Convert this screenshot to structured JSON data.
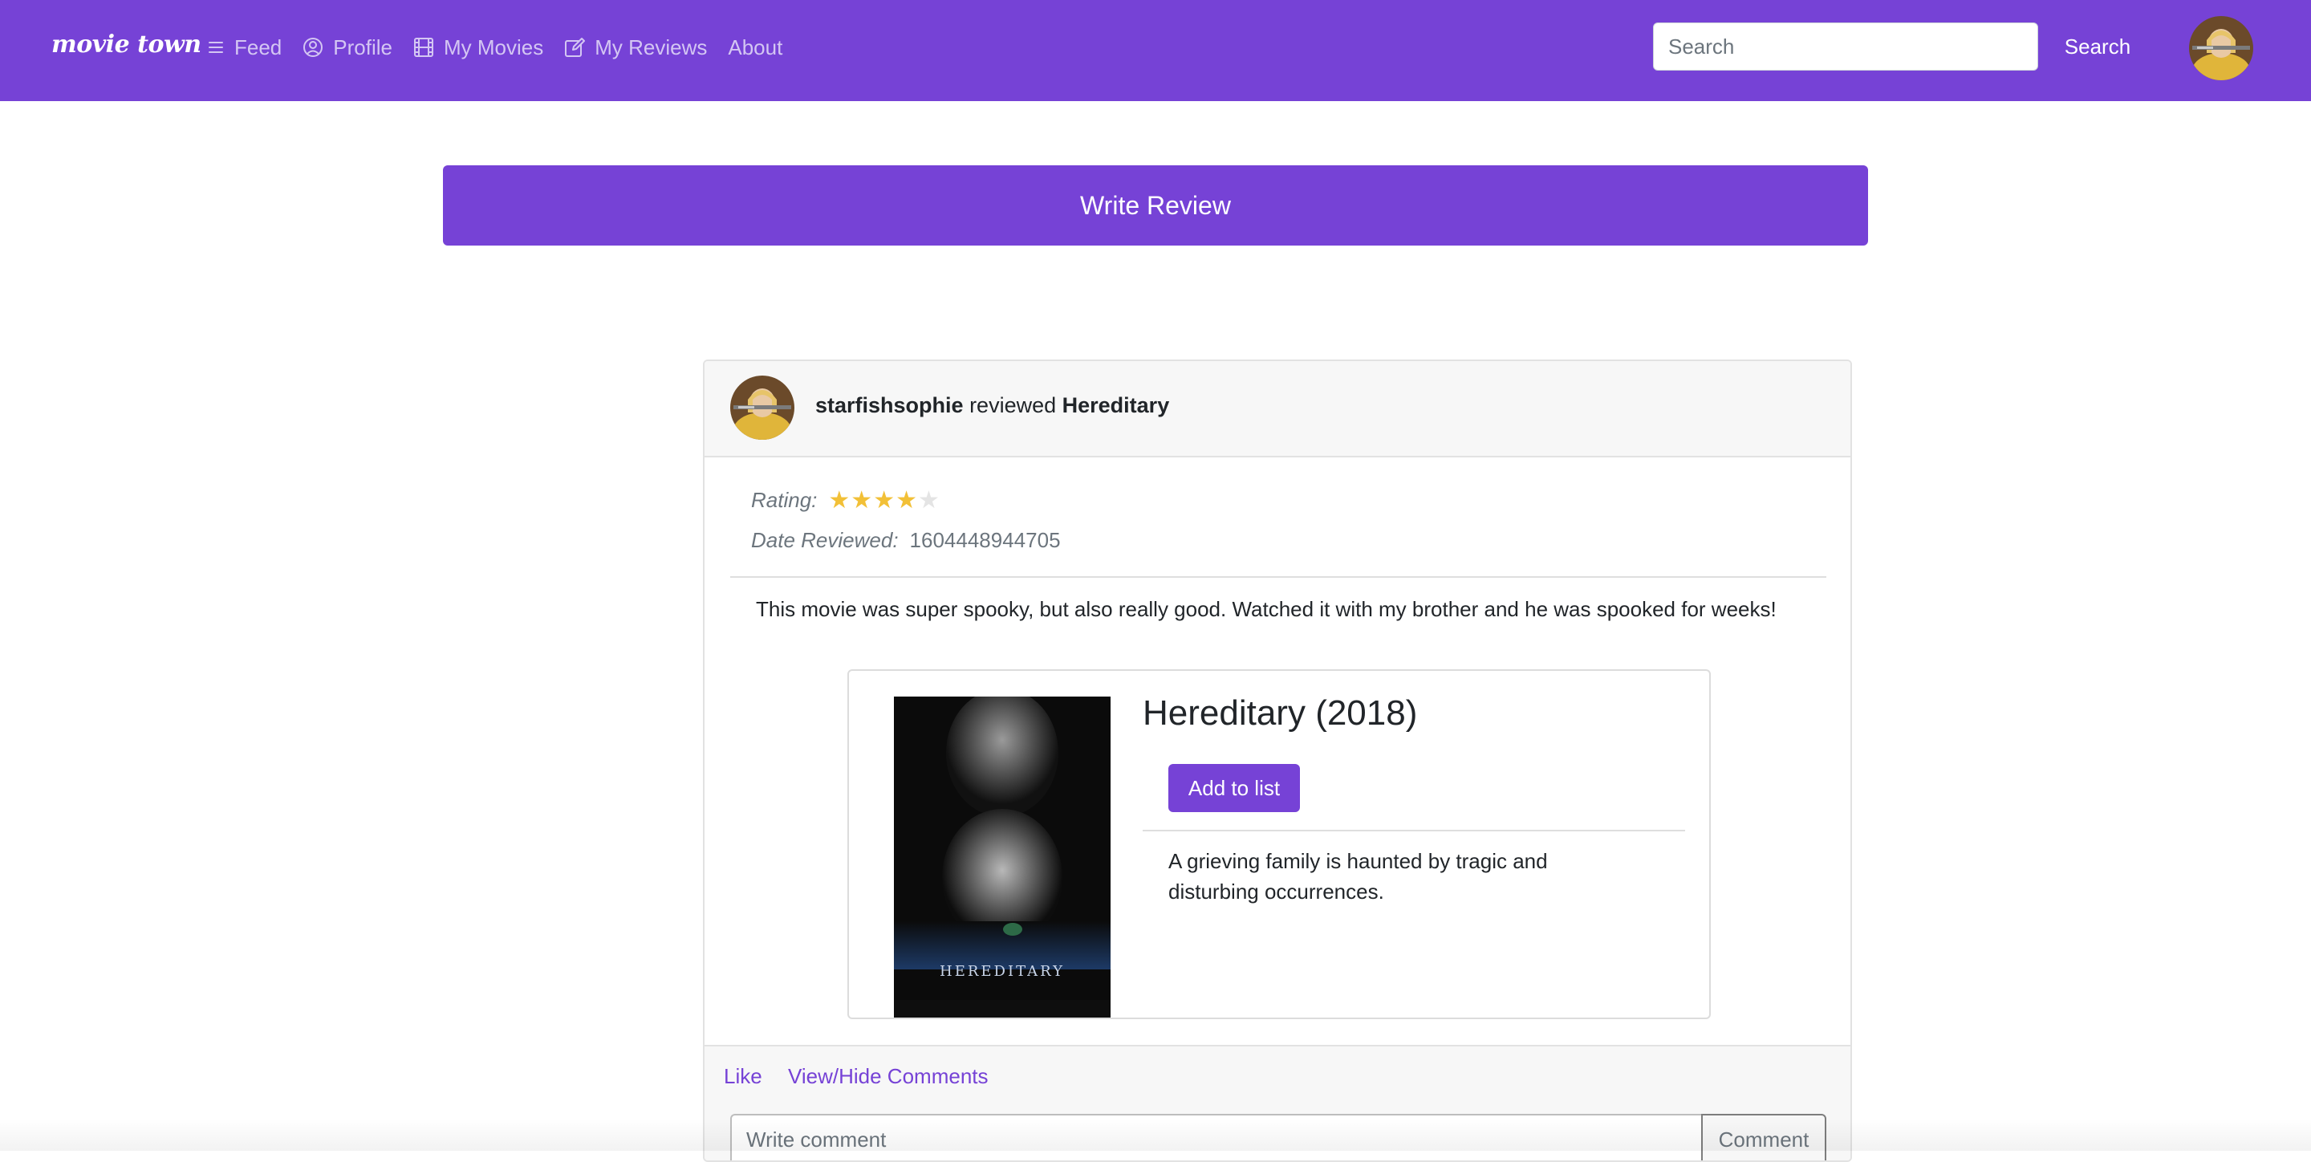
{
  "navbar": {
    "brand": "movie town",
    "links": [
      {
        "label": "Feed",
        "icon": "list-icon"
      },
      {
        "label": "Profile",
        "icon": "user-circle-icon"
      },
      {
        "label": "My Movies",
        "icon": "film-icon"
      },
      {
        "label": "My Reviews",
        "icon": "edit-icon"
      },
      {
        "label": "About",
        "icon": ""
      }
    ],
    "search_placeholder": "Search",
    "search_button": "Search",
    "avatar_icon": "user-avatar"
  },
  "write_review_label": "Write Review",
  "review": {
    "username": "starfishsophie",
    "action_text": "reviewed",
    "movie_name": "Hereditary",
    "rating_label": "Rating:",
    "rating": 4,
    "rating_max": 5,
    "date_label": "Date Reviewed:",
    "date_value": "1604448944705",
    "body": "This movie was super spooky, but also really good. Watched it with my brother and he was spooked for weeks!",
    "movie": {
      "title": "Hereditary (2018)",
      "poster_text": "HEREDITARY",
      "add_button": "Add to list",
      "description": "A grieving family is haunted by tragic and disturbing occurrences."
    },
    "footer": {
      "like": "Like",
      "toggle_comments": "View/Hide Comments",
      "comment_placeholder": "Write comment",
      "comment_button": "Comment"
    }
  },
  "colors": {
    "accent": "#7642d6",
    "star": "#f2c037"
  }
}
